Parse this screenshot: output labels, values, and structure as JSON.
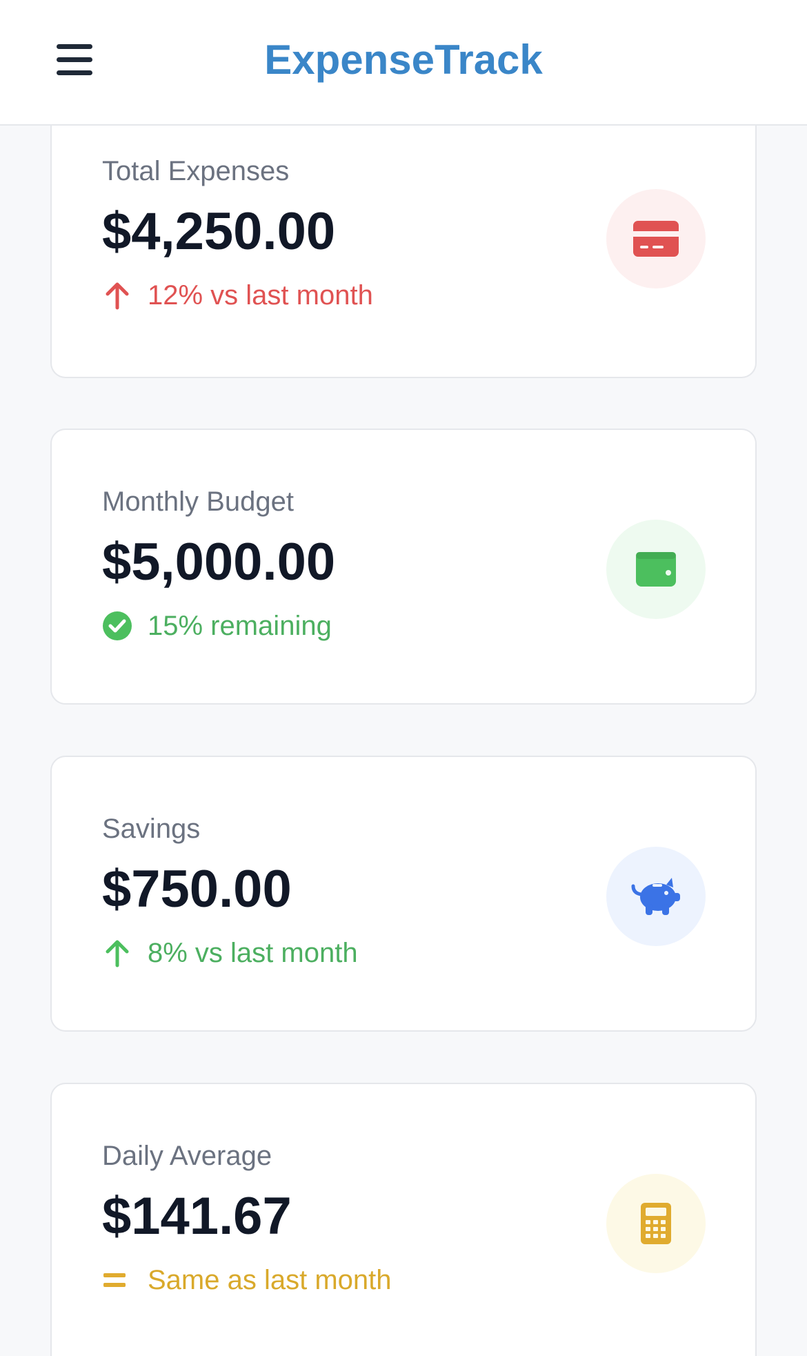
{
  "header": {
    "title": "ExpenseTrack"
  },
  "cards": [
    {
      "label": "Total Expenses",
      "value": "$4,250.00",
      "trend": "12% vs last month",
      "trend_color": "#e05252",
      "trend_icon": "arrow-up-icon",
      "icon": "credit-card-icon",
      "icon_color": "#e05252",
      "icon_bg": "#fdf0f0"
    },
    {
      "label": "Monthly Budget",
      "value": "$5,000.00",
      "trend": "15% remaining",
      "trend_color": "#4caf60",
      "trend_icon": "check-circle-icon",
      "icon": "wallet-icon",
      "icon_color": "#4cbf5e",
      "icon_bg": "#eefaf0"
    },
    {
      "label": "Savings",
      "value": "$750.00",
      "trend": "8% vs last month",
      "trend_color": "#4caf60",
      "trend_icon": "arrow-up-icon",
      "icon": "piggy-bank-icon",
      "icon_color": "#3b73e6",
      "icon_bg": "#edf3fe"
    },
    {
      "label": "Daily Average",
      "value": "$141.67",
      "trend": "Same as last month",
      "trend_color": "#d9a92b",
      "trend_icon": "equals-icon",
      "icon": "calculator-icon",
      "icon_color": "#e0ab2f",
      "icon_bg": "#fdf9e6"
    }
  ]
}
